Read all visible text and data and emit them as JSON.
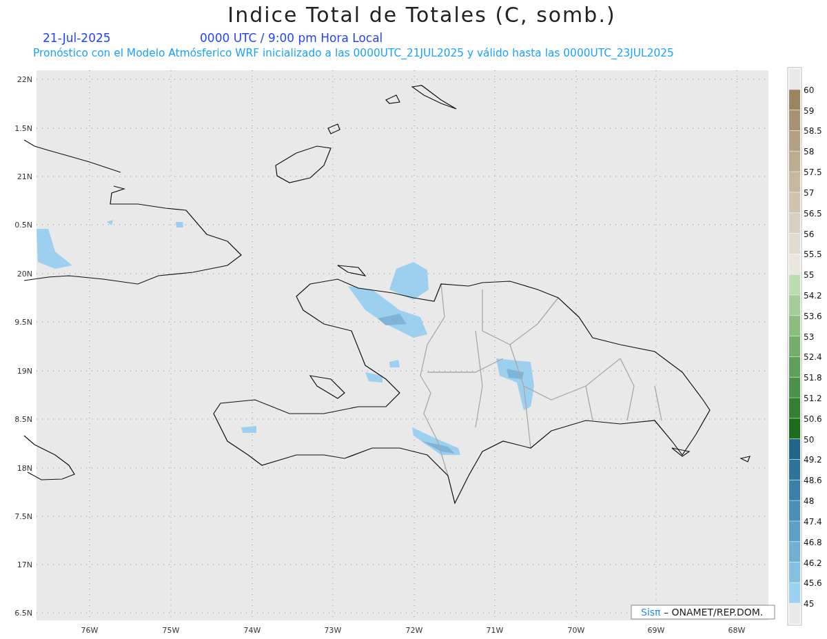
{
  "title": "Indice Total de Totales (C, somb.)",
  "date": "21-Jul-2025",
  "time": "0000 UTC / 9:00 pm Hora Local",
  "subtitle": "Pronóstico con el Modelo Atmósferico WRF inicializado a las 0000UTC_21JUL2025 y válido hasta las 0000UTC_23JUL2025",
  "y_labels": [
    "22N",
    "1.5N",
    "21N",
    "0.5N",
    "20N",
    "9.5N",
    "19N",
    "8.5N",
    "18N",
    "7.5N",
    "17N",
    "6.5N"
  ],
  "x_labels": [
    "76W",
    "75W",
    "74W",
    "73W",
    "72W",
    "71W",
    "70W",
    "69W",
    "68W"
  ],
  "colorbar": {
    "labels": [
      "60",
      "59",
      "58.5",
      "58",
      "57.5",
      "57",
      "56.5",
      "56",
      "55.5",
      "55",
      "54.2",
      "53.6",
      "53",
      "52.4",
      "51.8",
      "51.2",
      "50.6",
      "50",
      "49.2",
      "48.6",
      "48",
      "47.4",
      "46.8",
      "46.2",
      "45.6",
      "45"
    ],
    "bands": [
      {
        "color": "#e9e9e9"
      },
      {
        "color": "#9a8560"
      },
      {
        "color": "#a89271"
      },
      {
        "color": "#b3a181"
      },
      {
        "color": "#bdac90"
      },
      {
        "color": "#c6b89e"
      },
      {
        "color": "#d0c4ae"
      },
      {
        "color": "#d9cfbe"
      },
      {
        "color": "#e2dace"
      },
      {
        "color": "#ebe6dd"
      },
      {
        "color": "#bcdcb0"
      },
      {
        "color": "#a3cc96"
      },
      {
        "color": "#8bbd80"
      },
      {
        "color": "#74ad6c"
      },
      {
        "color": "#5f9f5b"
      },
      {
        "color": "#4a904a"
      },
      {
        "color": "#347f34"
      },
      {
        "color": "#1c6e1c"
      },
      {
        "color": "#1f6688"
      },
      {
        "color": "#2d7499"
      },
      {
        "color": "#3a80a8"
      },
      {
        "color": "#4a8fb6"
      },
      {
        "color": "#5e9fc3"
      },
      {
        "color": "#72b0d2"
      },
      {
        "color": "#86c0e0"
      },
      {
        "color": "#9bd2f0"
      },
      {
        "color": "#e9e9e9"
      }
    ]
  },
  "credit": {
    "brand": "Sisπ",
    "text": "– ONAMET/REP.DOM."
  }
}
